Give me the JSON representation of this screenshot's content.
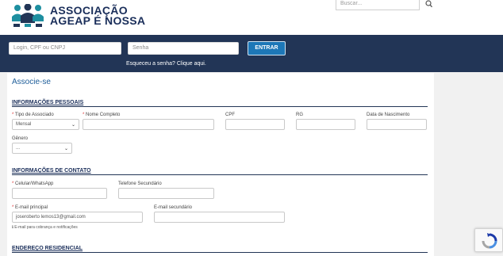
{
  "brand": {
    "line1": "ASSOCIAÇÃO",
    "line2": "AGEAP É NOSSA",
    "colors": {
      "navy": "#223556",
      "accent": "#1d77b7",
      "logo_teal": "#1e8fa0"
    }
  },
  "search": {
    "placeholder": "Buscar...",
    "icon": "search-icon"
  },
  "login": {
    "user_placeholder": "Login, CPF ou CNPJ",
    "password_placeholder": "Senha",
    "submit_label": "ENTRAR",
    "forgot_text": "Esqueceu a senha? Clique aqui."
  },
  "form": {
    "title": "Associe-se",
    "personal": {
      "heading": "INFORMAÇÕES PESSOAIS",
      "tipo_label": "Tipo de Associado",
      "tipo_value": "Mensal",
      "nome_label": "Nome Completo",
      "cpf_label": "CPF",
      "rg_label": "RG",
      "nascimento_label": "Data de Nascimento",
      "genero_label": "Gênero",
      "genero_value": "..."
    },
    "contact": {
      "heading": "INFORMAÇÕES DE CONTATO",
      "celular_label": "Celular/WhatsApp",
      "telefone_label": "Telefone Secundário",
      "email_label": "E-mail principal",
      "email_value": "joseroberto lemos13@gmail.com",
      "email2_label": "E-mail secundário",
      "email_hint": "E-mail para cobrança e notificações"
    },
    "address": {
      "heading": "ENDEREÇO RESIDENCIAL"
    },
    "required_mark": "*"
  }
}
